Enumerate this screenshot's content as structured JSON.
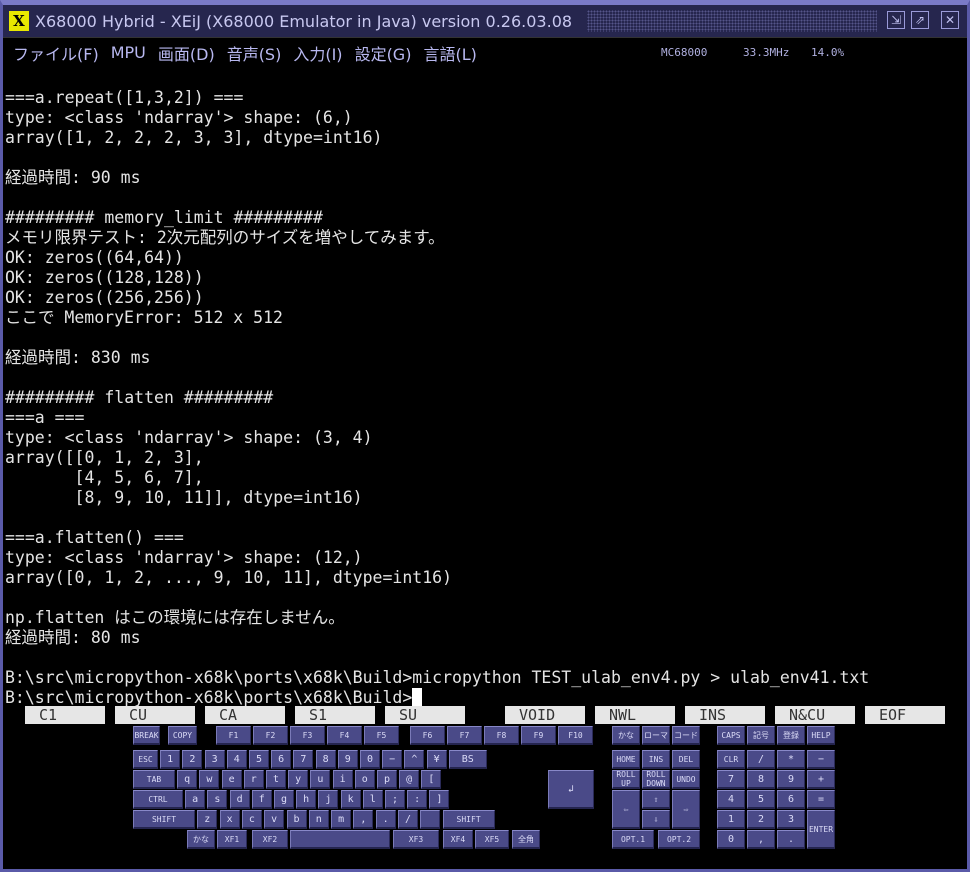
{
  "window": {
    "title": "X68000 Hybrid - XEiJ (X68000 Emulator in Java) version 0.26.03.08",
    "logo": "X",
    "controls": [
      "minimize-icon",
      "maximize-icon",
      "close-icon"
    ]
  },
  "menu": [
    "ファイル(F)",
    "MPU",
    "画面(D)",
    "音声(S)",
    "入力(I)",
    "設定(G)",
    "言語(L)"
  ],
  "status": {
    "cpu": "MC68000",
    "clock": "33.3MHz",
    "load": "14.0%"
  },
  "terminal": {
    "lines": [
      "",
      "===a.repeat([1,3,2]) ===",
      "type: <class 'ndarray'> shape: (6,)",
      "array([1, 2, 2, 2, 3, 3], dtype=int16)",
      "",
      "経過時間: 90 ms",
      "",
      "######### memory_limit #########",
      "メモリ限界テスト: 2次元配列のサイズを増やしてみます。",
      "OK: zeros((64,64))",
      "OK: zeros((128,128))",
      "OK: zeros((256,256))",
      "ここで MemoryError: 512 x 512",
      "",
      "経過時間: 830 ms",
      "",
      "######### flatten #########",
      "===a ===",
      "type: <class 'ndarray'> shape: (3, 4)",
      "array([[0, 1, 2, 3],",
      "       [4, 5, 6, 7],",
      "       [8, 9, 10, 11]], dtype=int16)",
      "",
      "===a.flatten() ===",
      "type: <class 'ndarray'> shape: (12,)",
      "array([0, 1, 2, ..., 9, 10, 11], dtype=int16)",
      "",
      "np.flatten はこの環境には存在しません。",
      "経過時間: 80 ms",
      "",
      "B:\\src\\micropython-x68k\\ports\\x68k\\Build>micropython TEST_ulab_env4.py > ulab_env41.txt"
    ],
    "prompt": "B:\\src\\micropython-x68k\\ports\\x68k\\Build>"
  },
  "function_keys": [
    "C1",
    "CU",
    "CA",
    "S1",
    "SU",
    "VOID",
    "NWL",
    "INS",
    "N&CU",
    "EOF"
  ],
  "keyboard": {
    "top": [
      "BREAK",
      "COPY",
      "F1",
      "F2",
      "F3",
      "F4",
      "F5",
      "F6",
      "F7",
      "F8",
      "F9",
      "F10",
      "かな",
      "ローマ",
      "コード",
      "CAPS",
      "記号",
      "登録",
      "HELP"
    ],
    "row1": [
      "ESC",
      "1",
      "2",
      "3",
      "4",
      "5",
      "6",
      "7",
      "8",
      "9",
      "0",
      "−",
      "^",
      "¥",
      "BS"
    ],
    "row2": [
      "TAB",
      "q",
      "w",
      "e",
      "r",
      "t",
      "y",
      "u",
      "i",
      "o",
      "p",
      "@",
      "["
    ],
    "row3": [
      "CTRL",
      "a",
      "s",
      "d",
      "f",
      "g",
      "h",
      "j",
      "k",
      "l",
      ";",
      ":",
      "]"
    ],
    "row4": [
      "SHIFT",
      "z",
      "x",
      "c",
      "v",
      "b",
      "n",
      "m",
      ",",
      ".",
      "/",
      "",
      "SHIFT"
    ],
    "row5": [
      "かな",
      "XF1",
      "XF2",
      "",
      "XF3",
      "XF4",
      "XF5",
      "全角"
    ],
    "return": "↲",
    "edit": [
      "HOME",
      "INS",
      "DEL",
      "ROLL\nUP",
      "ROLL\nDOWN",
      "UNDO",
      "⇦",
      "⇧",
      "⇨",
      "⇩",
      "OPT.1",
      "OPT.2"
    ],
    "numpad": [
      "CLR",
      "/",
      "*",
      "−",
      "7",
      "8",
      "9",
      "+",
      "4",
      "5",
      "6",
      "=",
      "1",
      "2",
      "3",
      "ENTER",
      "0",
      ",",
      "."
    ]
  }
}
